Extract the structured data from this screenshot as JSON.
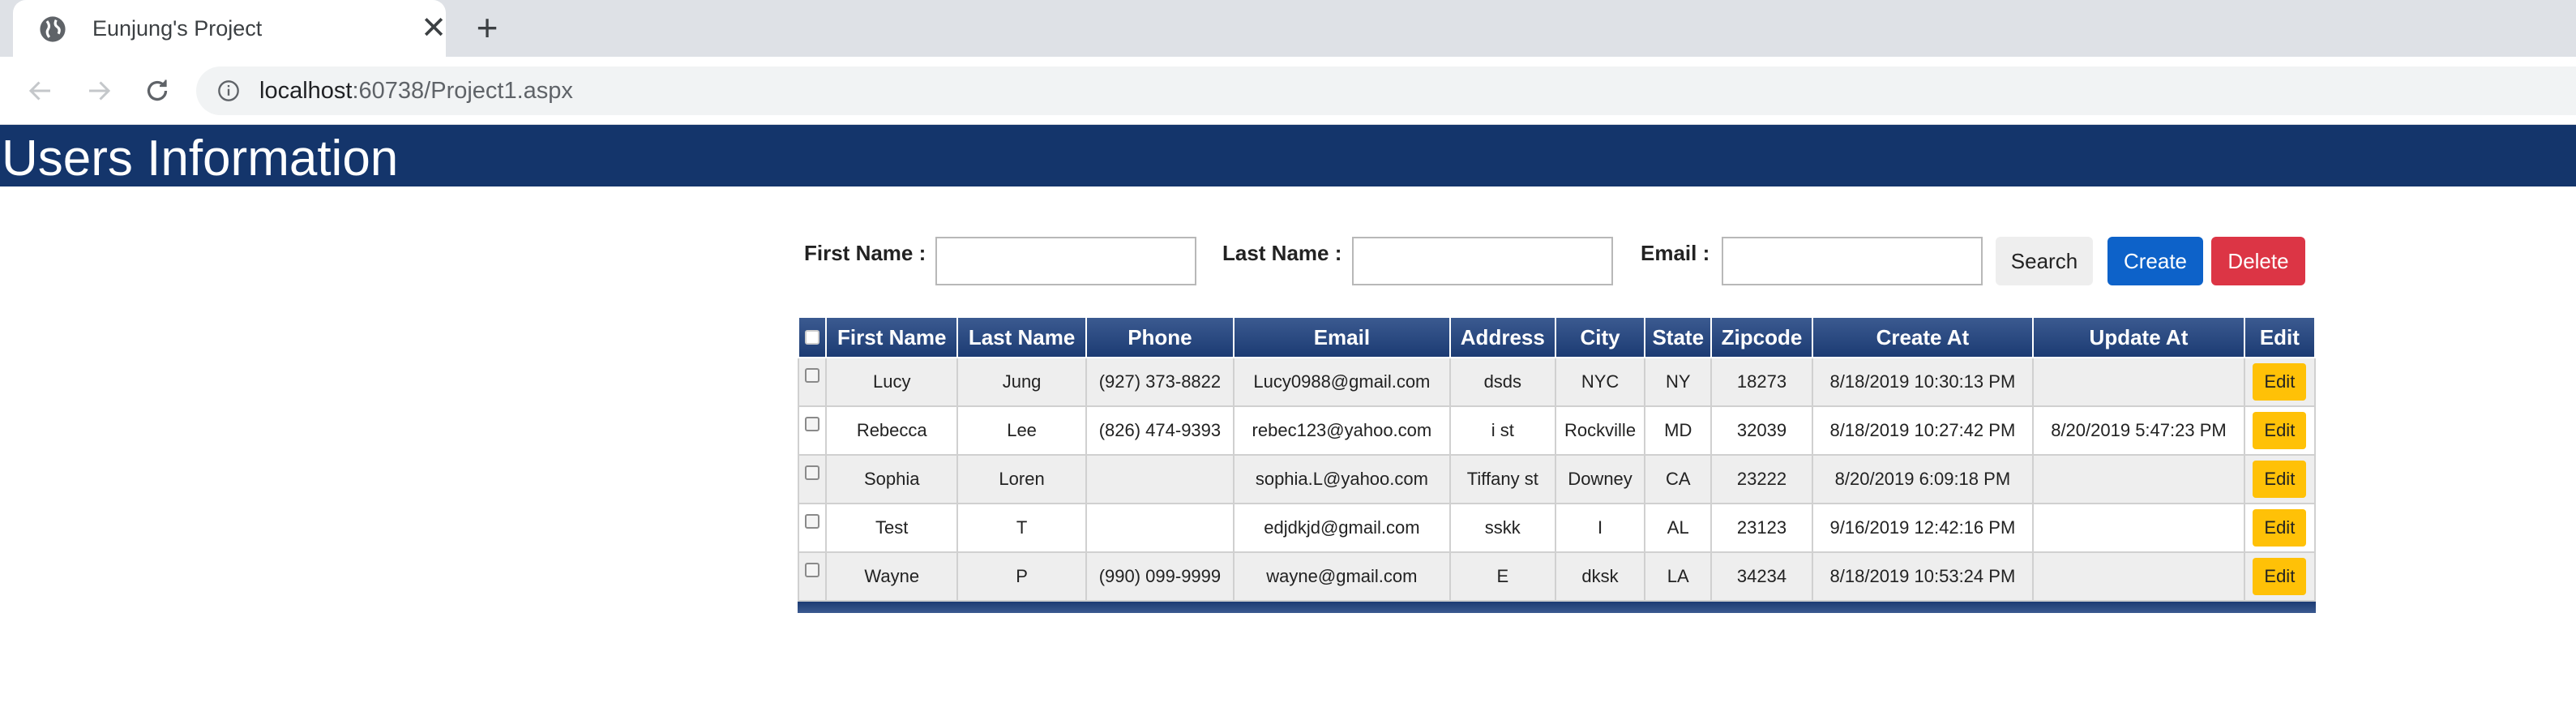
{
  "browser": {
    "tab_title": "Eunjung's Project",
    "close_glyph": "✕",
    "new_tab_glyph": "+",
    "url_host": "localhost",
    "url_rest": ":60738/Project1.aspx"
  },
  "header": {
    "title": "Users Information"
  },
  "search": {
    "first_name_label": "First Name :",
    "last_name_label": "Last Name :",
    "email_label": "Email :",
    "first_name_value": "",
    "last_name_value": "",
    "email_value": "",
    "search_button": "Search",
    "create_button": "Create",
    "delete_button": "Delete"
  },
  "table": {
    "columns": [
      "",
      "First Name",
      "Last Name",
      "Phone",
      "Email",
      "Address",
      "City",
      "State",
      "Zipcode",
      "Create At",
      "Update At",
      "Edit"
    ],
    "rows": [
      {
        "first": "Lucy",
        "last": "Jung",
        "phone": "(927) 373-8822",
        "email": "Lucy0988@gmail.com",
        "address": "dsds",
        "city": "NYC",
        "state": "NY",
        "zip": "18273",
        "created": "8/18/2019 10:30:13 PM",
        "updated": "",
        "edit": "Edit"
      },
      {
        "first": "Rebecca",
        "last": "Lee",
        "phone": "(826) 474-9393",
        "email": "rebec123@yahoo.com",
        "address": "i st",
        "city": "Rockville",
        "state": "MD",
        "zip": "32039",
        "created": "8/18/2019 10:27:42 PM",
        "updated": "8/20/2019 5:47:23 PM",
        "edit": "Edit"
      },
      {
        "first": "Sophia",
        "last": "Loren",
        "phone": "",
        "email": "sophia.L@yahoo.com",
        "address": "Tiffany st",
        "city": "Downey",
        "state": "CA",
        "zip": "23222",
        "created": "8/20/2019 6:09:18 PM",
        "updated": "",
        "edit": "Edit"
      },
      {
        "first": "Test",
        "last": "T",
        "phone": "",
        "email": "edjdkjd@gmail.com",
        "address": "sskk",
        "city": "I",
        "state": "AL",
        "zip": "23123",
        "created": "9/16/2019 12:42:16 PM",
        "updated": "",
        "edit": "Edit"
      },
      {
        "first": "Wayne",
        "last": "P",
        "phone": "(990) 099-9999",
        "email": "wayne@gmail.com",
        "address": "E",
        "city": "dksk",
        "state": "LA",
        "zip": "34234",
        "created": "8/18/2019 10:53:24 PM",
        "updated": "",
        "edit": "Edit"
      }
    ]
  },
  "colors": {
    "header_bg": "#14356b",
    "create_button": "#0d62c9",
    "delete_button": "#dc3545",
    "edit_button": "#ffc107"
  }
}
